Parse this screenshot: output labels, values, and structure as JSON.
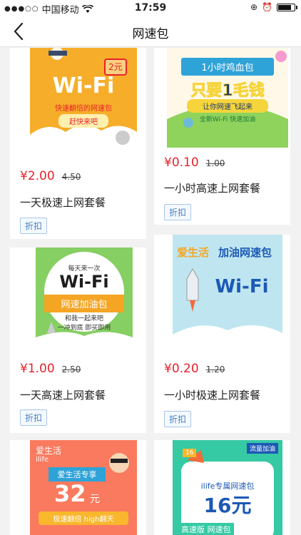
{
  "status_bar": {
    "carrier": "中国移动",
    "time": "17:59",
    "battery_level": 0.85
  },
  "nav": {
    "title": "网速包"
  },
  "products": [
    {
      "price": "¥2.00",
      "original_price": "4.50",
      "name": "一天极速上网套餐",
      "tag": "折扣",
      "banner": {
        "headline": "Wi-Fi",
        "badge": "2元",
        "subtitle": "快速翻倍的网速包",
        "cta": "赶快来吧"
      }
    },
    {
      "price": "¥0.10",
      "original_price": "1.00",
      "name": "一小时高速上网套餐",
      "tag": "折扣",
      "banner": {
        "ribbon": "1小时鸡血包",
        "headline": "只要1毛钱",
        "subtitle": "让你网速飞起来",
        "footer": "全新Wi-Fi  快速加油"
      }
    },
    {
      "price": "¥1.00",
      "original_price": "2.50",
      "name": "一天高速上网套餐",
      "tag": "折扣",
      "banner": {
        "top": "每天来一次",
        "headline": "Wi-Fi",
        "ribbon": "网速加油包",
        "line1": "和我一起来吧",
        "line2": "一冲到底  即买即用"
      }
    },
    {
      "price": "¥0.20",
      "original_price": "1.20",
      "name": "一小时极速上网套餐",
      "tag": "折扣",
      "banner": {
        "title_a": "爱生活",
        "title_b": "加油网速包",
        "headline": "Wi-Fi"
      }
    },
    {
      "banner": {
        "top": "爱生活",
        "sub": "ilife",
        "ribbon": "爱生活专享",
        "headline": "32",
        "unit": "元",
        "footer": "极速翻倍  high翻天"
      }
    },
    {
      "banner": {
        "tag": "流量加油",
        "badge": "16",
        "sub": "ilife专属网速包",
        "headline": "16元",
        "footer": "高速版  网速包"
      }
    }
  ]
}
